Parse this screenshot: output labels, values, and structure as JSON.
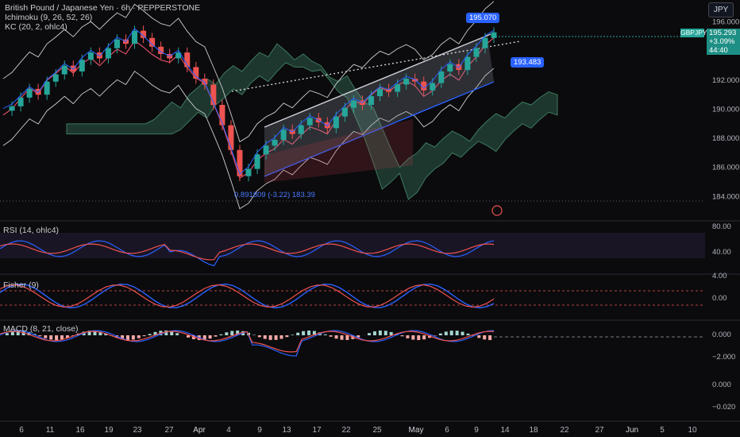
{
  "header": {
    "title": "British Pound / Japanese Yen · 6h · PEPPERSTONE",
    "ichimoku": "Ichimoku (9, 26, 52, 26)",
    "kc": "KC (20, 2, ohlc4)",
    "currency": "JPY"
  },
  "price_tags": {
    "symbol": "GBPJPY",
    "last": "195.293",
    "change": "+3.09%",
    "countdown": "44:40",
    "high_label": "195.070",
    "target_label": "193.483",
    "low_label": "0.891809 (-3.22) 183.39"
  },
  "panes": {
    "rsi": "RSI (14, ohlc4)",
    "fisher": "Fisher (9)",
    "macd": "MACD (8, 21, close)"
  },
  "colors": {
    "bg": "#0b0b0d",
    "up": "#26a69a",
    "down": "#ef5350",
    "blue": "#2962ff",
    "cloud": "#2e5d4a",
    "channel": "#d1d4dc"
  },
  "chart_data": [
    {
      "type": "candlestick",
      "title": "British Pound / Japanese Yen · 6h · PEPPERSTONE",
      "ylim": [
        183.2,
        196.2
      ],
      "yticks": [
        "196.000",
        "194.000",
        "192.000",
        "190.000",
        "188.000",
        "186.000",
        "184.000"
      ],
      "xticks": [
        "6",
        "11",
        "16",
        "19",
        "23",
        "27",
        "Apr",
        "4",
        "9",
        "13",
        "17",
        "22",
        "25",
        "May",
        "6",
        "9",
        "14",
        "18",
        "22",
        "27",
        "Jun",
        "5",
        "10"
      ],
      "close_series": [
        189.9,
        190.2,
        190.8,
        191.4,
        191.0,
        191.9,
        192.4,
        193.0,
        192.6,
        193.4,
        193.9,
        193.5,
        194.2,
        194.8,
        194.5,
        195.4,
        194.9,
        194.3,
        193.8,
        193.5,
        193.9,
        192.9,
        192.1,
        191.7,
        190.3,
        188.9,
        187.2,
        185.4,
        185.9,
        186.9,
        187.5,
        187.9,
        188.6,
        188.3,
        188.9,
        189.4,
        189.1,
        188.7,
        189.5,
        190.1,
        190.6,
        190.3,
        190.9,
        191.4,
        191.2,
        191.7,
        192.1,
        191.9,
        191.3,
        191.8,
        192.6,
        193.1,
        192.7,
        193.6,
        194.2,
        194.9,
        195.29
      ]
    },
    {
      "type": "line",
      "title": "RSI (14, ohlc4)",
      "yticks": [
        "80.00",
        "40.00"
      ]
    },
    {
      "type": "line",
      "title": "Fisher (9)",
      "yticks": [
        "4.00",
        "0.00"
      ]
    },
    {
      "type": "bar",
      "title": "MACD (8, 21, close)",
      "yticks": [
        "0.000",
        "−2.000",
        "0.000",
        "−0.020"
      ]
    }
  ]
}
